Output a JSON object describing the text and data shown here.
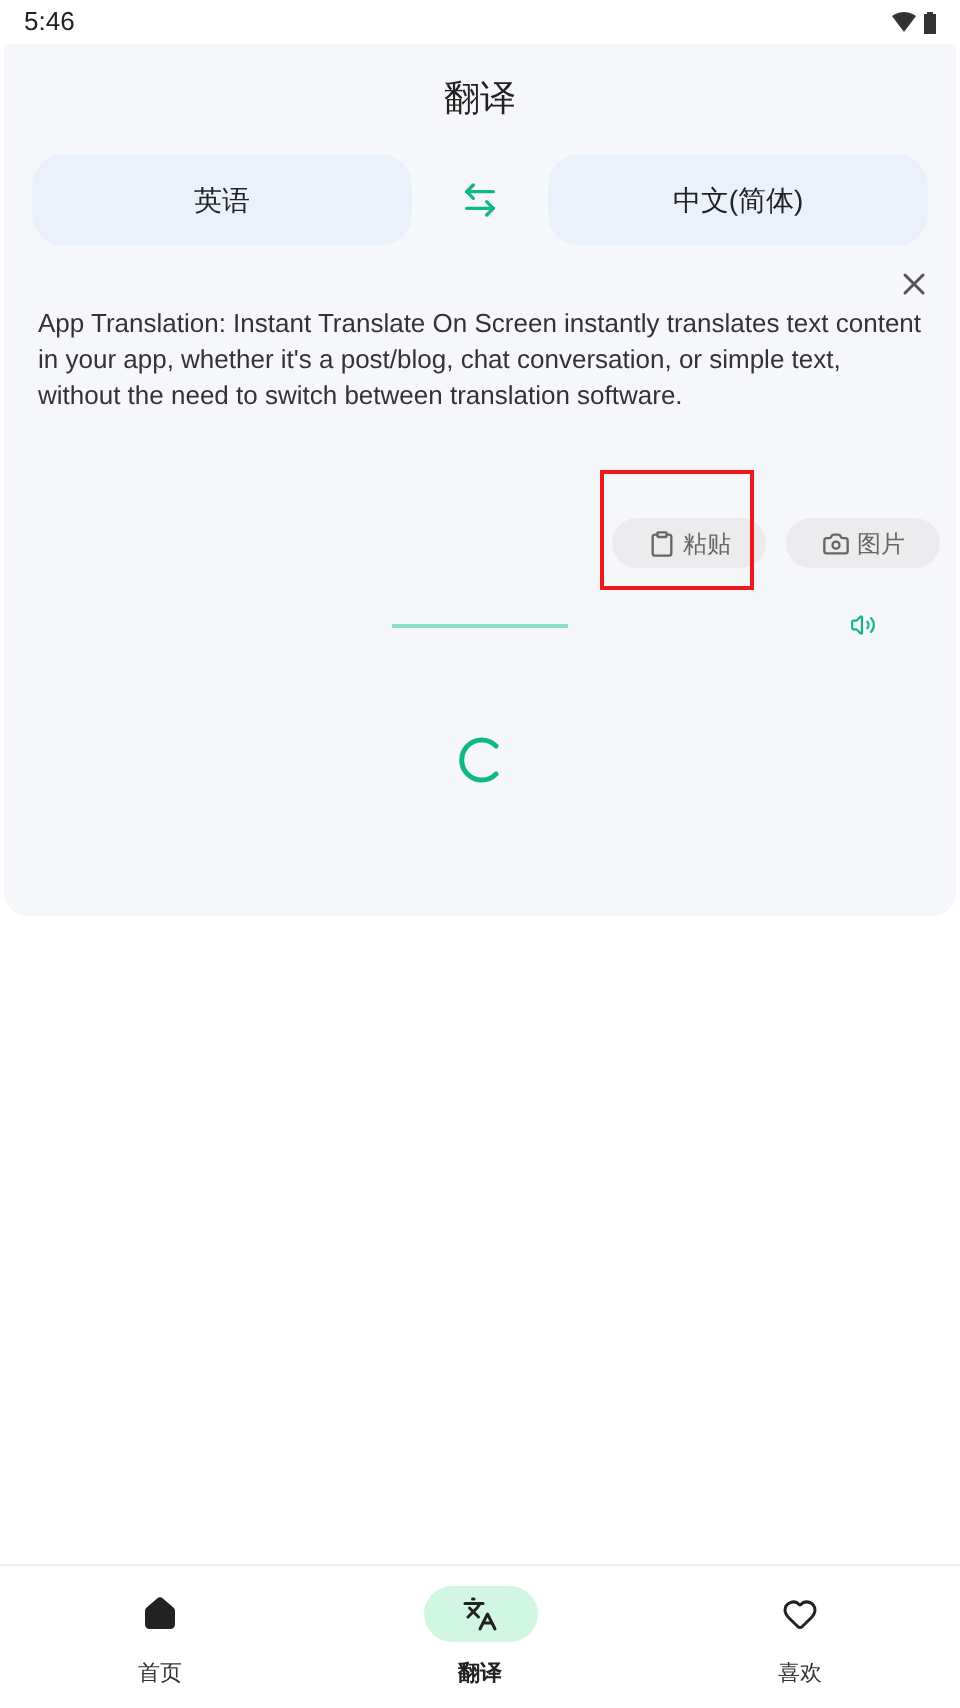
{
  "status_bar": {
    "time": "5:46"
  },
  "header": {
    "title": "翻译"
  },
  "languages": {
    "source": "英语",
    "target": "中文(简体)"
  },
  "input": {
    "text": "App Translation: Instant Translate On Screen instantly translates text content in your app, whether it's a post/blog, chat conversation, or simple text, without the need to switch between translation software."
  },
  "actions": [
    {
      "kind": "paste",
      "label": "粘贴",
      "highlighted": true
    },
    {
      "kind": "image",
      "label": "图片",
      "highlighted": false
    }
  ],
  "output": {
    "loading": true
  },
  "bottom_nav": [
    {
      "kind": "home",
      "label": "首页",
      "selected": false
    },
    {
      "kind": "translate",
      "label": "翻译",
      "selected": true
    },
    {
      "kind": "favorite",
      "label": "喜欢",
      "selected": false
    }
  ]
}
